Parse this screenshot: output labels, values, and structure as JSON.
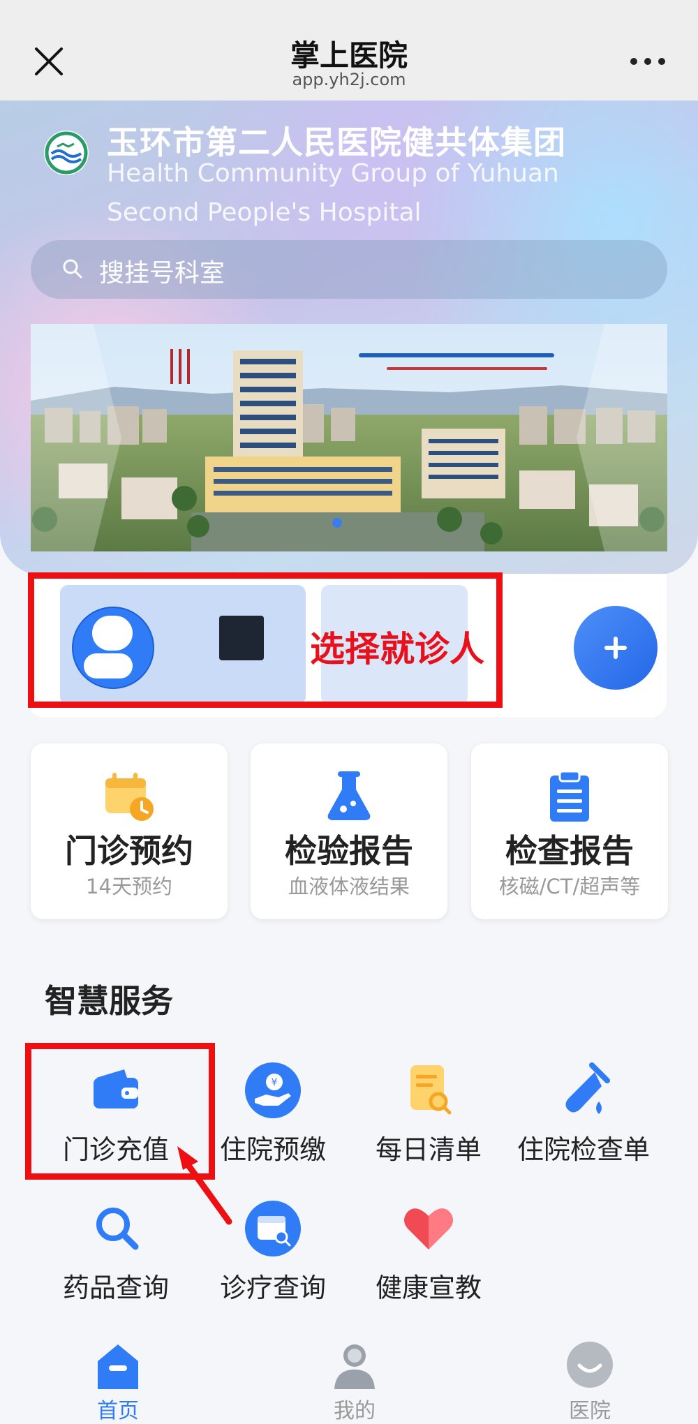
{
  "nav": {
    "title": "掌上医院",
    "url": "app.yh2j.com"
  },
  "hero": {
    "hospital_name_cn": "玉环市第二人民医院健共体集团",
    "hospital_name_en_line1": "Health Community Group of Yuhuan",
    "hospital_name_en_line2": "Second People's Hospital",
    "search_placeholder": "搜挂号科室"
  },
  "patient": {
    "select_label": "选择就诊人"
  },
  "quick_cards": [
    {
      "title": "门诊预约",
      "subtitle": "14天预约",
      "icon": "calendar-clock-icon"
    },
    {
      "title": "检验报告",
      "subtitle": "血液体液结果",
      "icon": "flask-icon"
    },
    {
      "title": "检查报告",
      "subtitle": "核磁/CT/超声等",
      "icon": "clipboard-icon"
    }
  ],
  "services": {
    "title": "智慧服务",
    "items": [
      {
        "label": "门诊充值",
        "icon": "wallet-icon"
      },
      {
        "label": "住院预缴",
        "icon": "hand-coin-icon"
      },
      {
        "label": "每日清单",
        "icon": "bill-search-icon"
      },
      {
        "label": "住院检查单",
        "icon": "test-tube-icon"
      },
      {
        "label": "药品查询",
        "icon": "search-icon"
      },
      {
        "label": "诊疗查询",
        "icon": "calendar-search-icon"
      },
      {
        "label": "健康宣教",
        "icon": "heart-icon"
      }
    ]
  },
  "tabbar": {
    "items": [
      {
        "label": "首页",
        "icon": "home-icon"
      },
      {
        "label": "我的",
        "icon": "user-icon"
      },
      {
        "label": "医院",
        "icon": "hospital-icon"
      }
    ]
  },
  "colors": {
    "accent": "#2f7cf6",
    "highlight_red": "#ee0f12"
  }
}
